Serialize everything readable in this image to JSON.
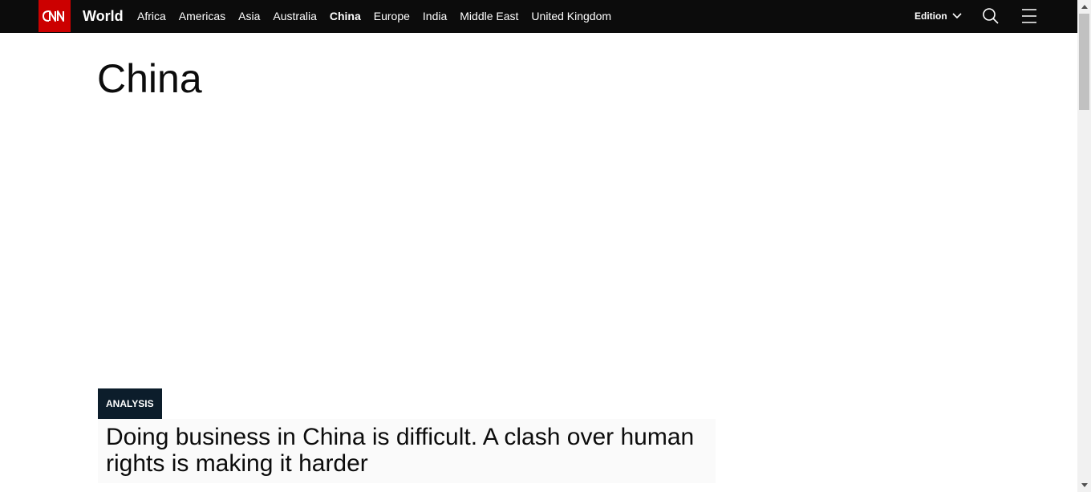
{
  "header": {
    "logo_text": "CNN",
    "section_title": "World",
    "nav_links": [
      {
        "label": "Africa",
        "active": false
      },
      {
        "label": "Americas",
        "active": false
      },
      {
        "label": "Asia",
        "active": false
      },
      {
        "label": "Australia",
        "active": false
      },
      {
        "label": "China",
        "active": true
      },
      {
        "label": "Europe",
        "active": false
      },
      {
        "label": "India",
        "active": false
      },
      {
        "label": "Middle East",
        "active": false
      },
      {
        "label": "United Kingdom",
        "active": false
      }
    ],
    "edition_label": "Edition",
    "icons": {
      "search": "search-icon",
      "menu": "hamburger-menu-icon",
      "edition_dropdown": "chevron-down-icon"
    }
  },
  "main": {
    "page_title": "China",
    "featured": {
      "badge": "ANALYSIS",
      "headline": "Doing business in China is difficult. A clash over human rights is making it harder"
    }
  },
  "colors": {
    "nav_background": "#0c0c0c",
    "brand_red": "#cc0000",
    "badge_background": "#0c1d2b",
    "headline_background": "#fafafa"
  }
}
